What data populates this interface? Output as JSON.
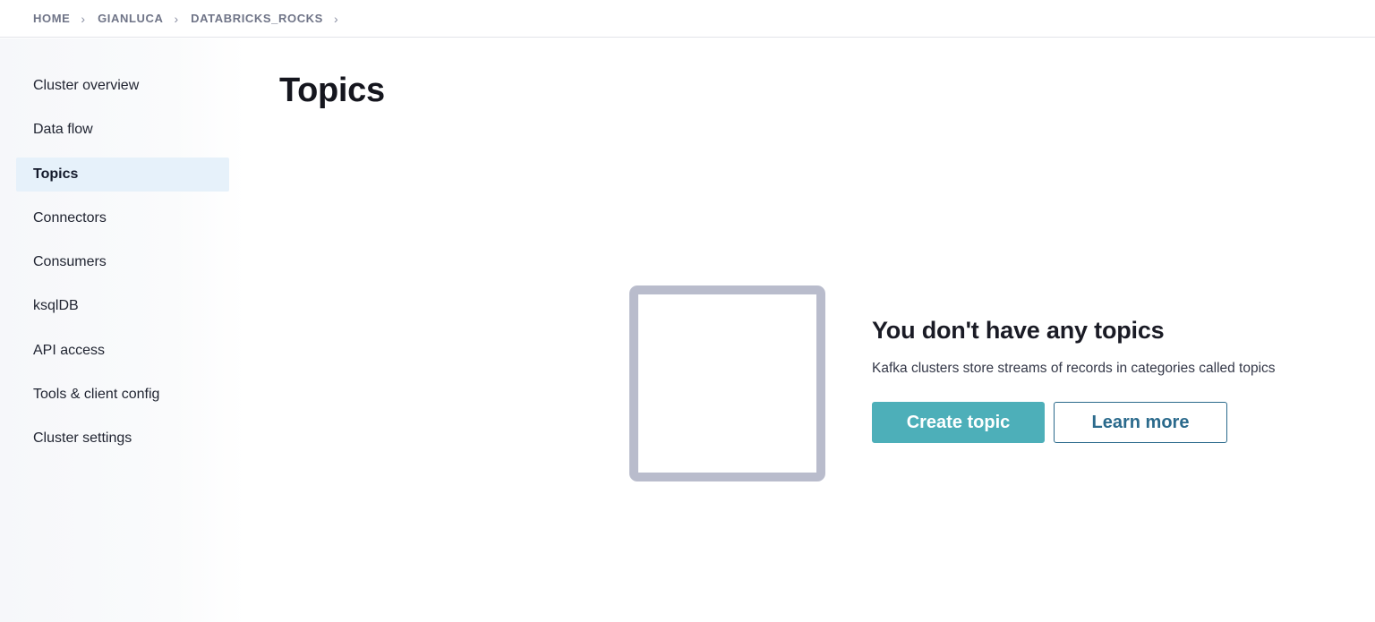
{
  "breadcrumb": {
    "items": [
      "HOME",
      "GIANLUCA",
      "DATABRICKS_ROCKS"
    ],
    "separator": "›"
  },
  "sidebar": {
    "items": [
      {
        "label": "Cluster overview",
        "active": false
      },
      {
        "label": "Data flow",
        "active": false
      },
      {
        "label": "Topics",
        "active": true
      },
      {
        "label": "Connectors",
        "active": false
      },
      {
        "label": "Consumers",
        "active": false
      },
      {
        "label": "ksqlDB",
        "active": false
      },
      {
        "label": "API access",
        "active": false
      },
      {
        "label": "Tools & client config",
        "active": false
      },
      {
        "label": "Cluster settings",
        "active": false
      }
    ]
  },
  "main": {
    "title": "Topics",
    "empty_state": {
      "heading": "You don't have any topics",
      "description": "Kafka clusters store streams of records in categories called topics",
      "primary_button": "Create topic",
      "secondary_button": "Learn more"
    }
  },
  "colors": {
    "accent": "#4dafb9",
    "link": "#2b6a8c",
    "active_nav_bg": "#e6f1fa",
    "illustration_border": "#b9bccc"
  }
}
